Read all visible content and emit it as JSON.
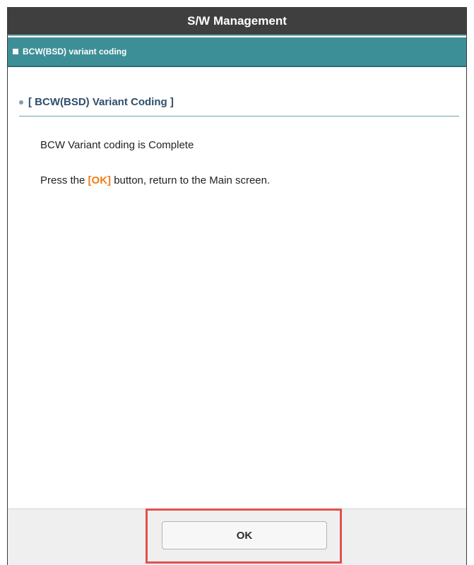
{
  "window": {
    "title": "S/W Management"
  },
  "section": {
    "label": "BCW(BSD) variant coding"
  },
  "content": {
    "heading": "[ BCW(BSD) Variant Coding ]",
    "message_line1": "BCW Variant coding is Complete",
    "message_line2_prefix": "Press the ",
    "message_line2_ok": "[OK]",
    "message_line2_suffix": " button, return to the Main screen."
  },
  "footer": {
    "ok_label": "OK"
  },
  "colors": {
    "title_bar": "#3f3f3f",
    "section_bar": "#3d8f97",
    "accent_ok": "#f27c16",
    "highlight": "#e0514e"
  }
}
